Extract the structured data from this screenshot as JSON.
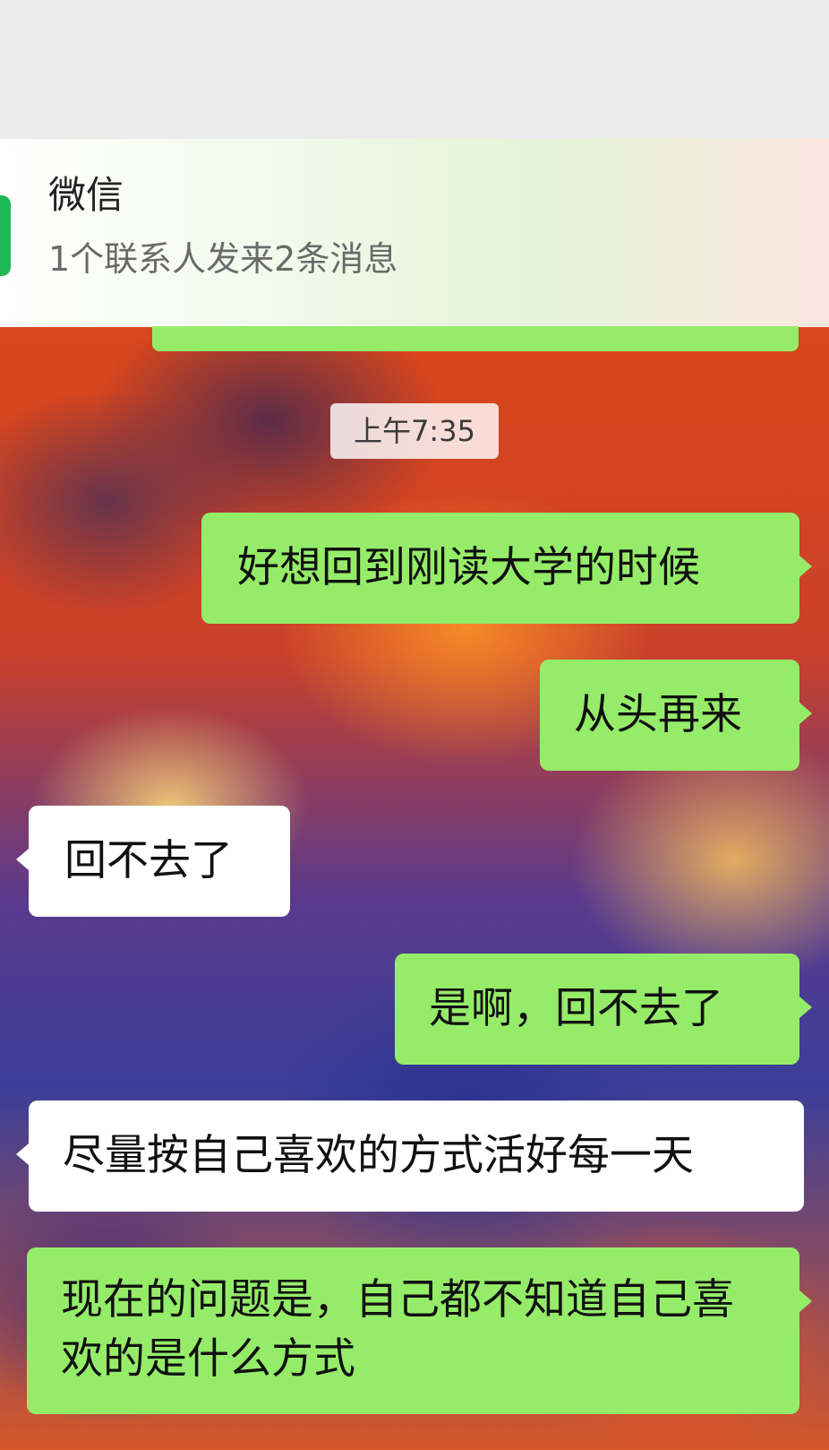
{
  "notification": {
    "app_name": "微信",
    "summary": "1个联系人发来2条消息"
  },
  "chat": {
    "timestamp": "上午7:35",
    "messages": [
      {
        "direction": "outgoing",
        "text": "好想回到刚读大学的时候"
      },
      {
        "direction": "outgoing",
        "text": "从头再来"
      },
      {
        "direction": "incoming",
        "text": "回不去了"
      },
      {
        "direction": "outgoing",
        "text": "是啊，回不去了"
      },
      {
        "direction": "incoming",
        "text": "尽量按自己喜欢的方式活好每一天"
      },
      {
        "direction": "outgoing",
        "text": "现在的问题是，自己都不知道自己喜欢的是什么方式"
      }
    ]
  },
  "colors": {
    "outgoing_bubble": "#95ec69",
    "incoming_bubble": "#ffffff",
    "app_icon": "#1db954"
  }
}
